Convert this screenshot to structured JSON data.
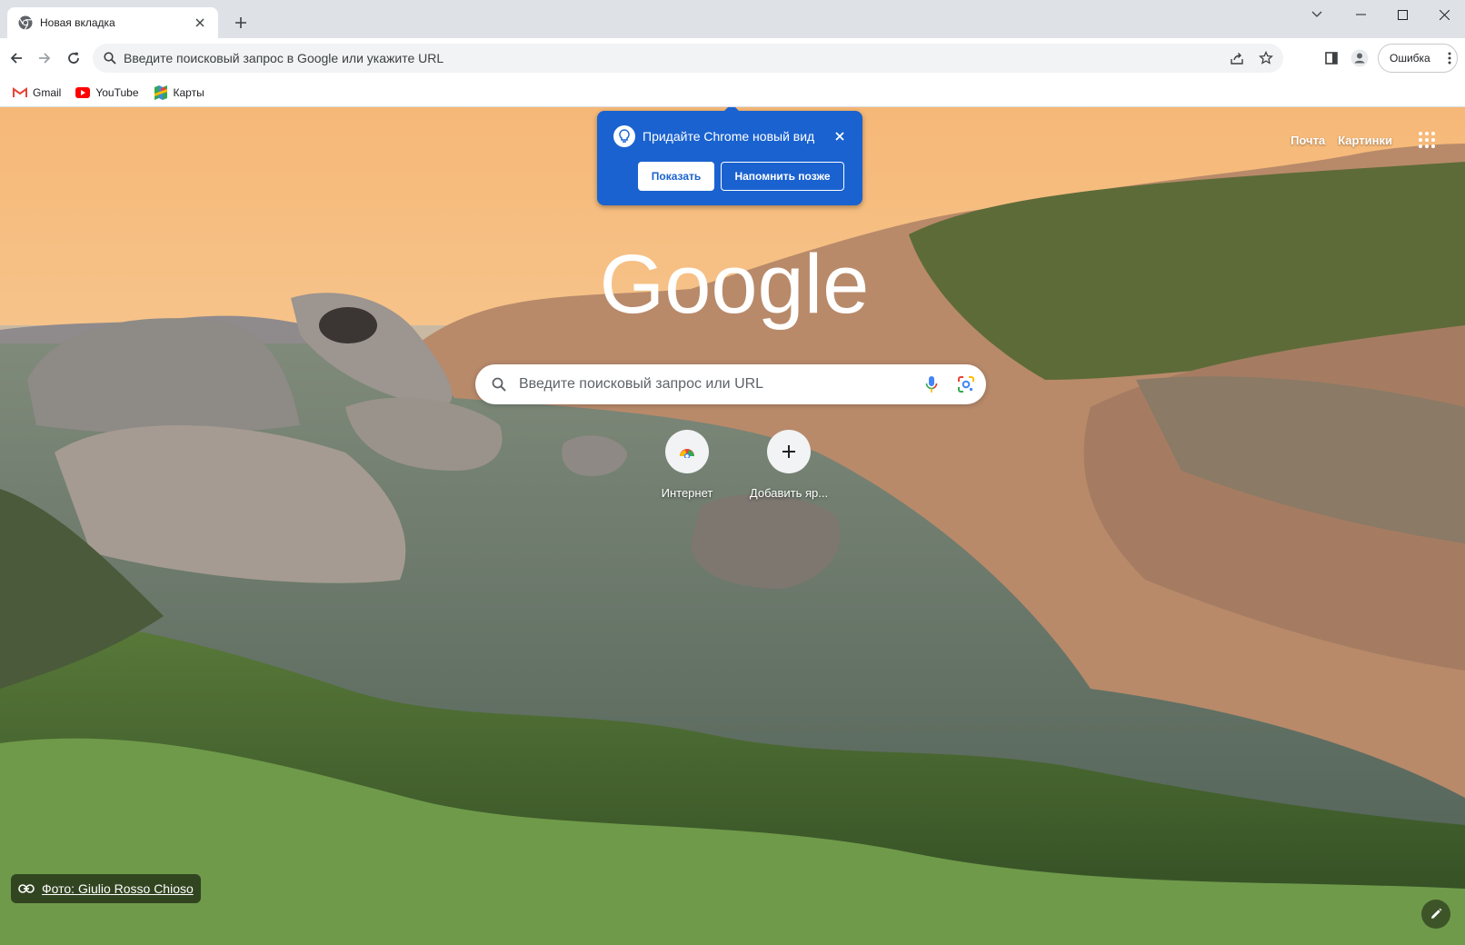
{
  "tab": {
    "title": "Новая вкладка"
  },
  "toolbar": {
    "omnibox_placeholder": "Введите поисковый запрос в Google или укажите URL",
    "error_label": "Ошибка"
  },
  "bookmarks": [
    {
      "label": "Gmail",
      "icon": "gmail-icon"
    },
    {
      "label": "YouTube",
      "icon": "youtube-icon"
    },
    {
      "label": "Карты",
      "icon": "maps-icon"
    }
  ],
  "ntp": {
    "top_links": {
      "mail": "Почта",
      "images": "Картинки"
    },
    "promo": {
      "text": "Придайте Chrome новый вид",
      "show_label": "Показать",
      "later_label": "Напомнить позже"
    },
    "logo_text": "Google",
    "search_placeholder": "Введите поисковый запрос или URL",
    "shortcuts": [
      {
        "label": "Интернет",
        "icon": "chrome-web-store-icon"
      },
      {
        "label": "Добавить яр...",
        "icon": "plus-icon"
      }
    ],
    "attribution": "Фото: Giulio Rosso Chioso"
  },
  "colors": {
    "promo_blue": "#1a62d0",
    "tab_strip": "#dee1e6",
    "omnibox": "#f1f3f4"
  }
}
